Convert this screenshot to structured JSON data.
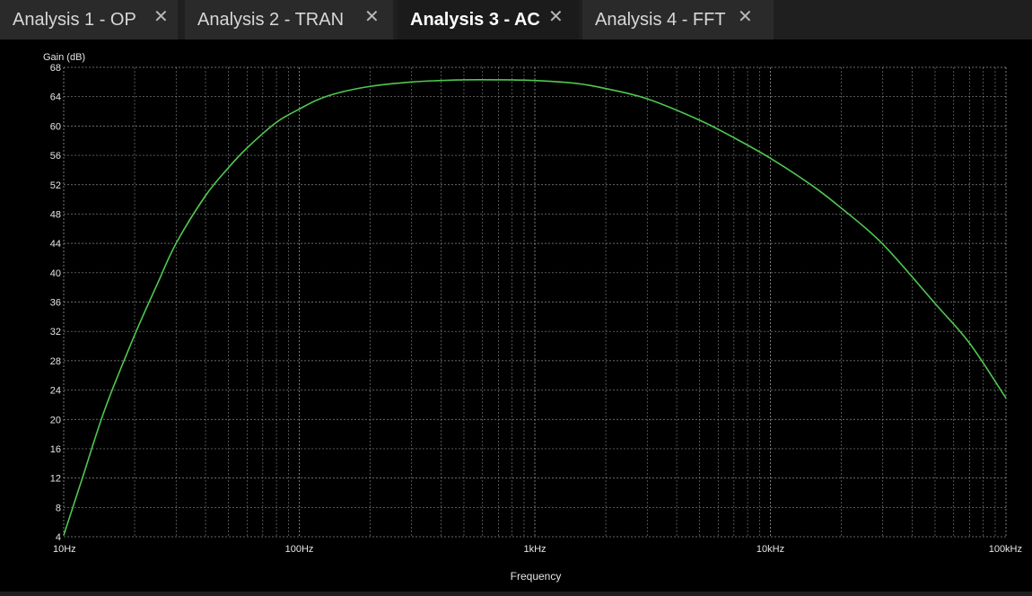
{
  "tabs": [
    {
      "label": "Analysis 1 - OP",
      "active": false
    },
    {
      "label": "Analysis 2 - TRAN",
      "active": false
    },
    {
      "label": "Analysis 3 - AC",
      "active": true
    },
    {
      "label": "Analysis 4 - FFT",
      "active": false
    }
  ],
  "tab_close_glyph": "✕",
  "colors": {
    "trace": "#4fc84f",
    "grid": "#8a8a8a",
    "background": "#000000",
    "text": "#e6e6e6"
  },
  "chart_data": {
    "type": "line",
    "title": "",
    "xlabel": "Frequency",
    "ylabel": "Gain (dB)",
    "xscale": "log",
    "xlim": [
      10,
      100000
    ],
    "ylim": [
      4,
      68
    ],
    "grid": true,
    "x_tick_labels": [
      "10Hz",
      "100Hz",
      "1kHz",
      "10kHz",
      "100kHz"
    ],
    "y_ticks": [
      4,
      8,
      12,
      16,
      20,
      24,
      28,
      32,
      36,
      40,
      44,
      48,
      52,
      56,
      60,
      64,
      68
    ],
    "series": [
      {
        "x": [
          10,
          12,
          15,
          20,
          25,
          30,
          40,
          50,
          60,
          80,
          100,
          120,
          150,
          200,
          300,
          400,
          500,
          700,
          1000,
          1500,
          2000,
          3000,
          5000,
          7000,
          10000,
          15000,
          20000,
          30000,
          50000,
          70000,
          100000
        ],
        "y": [
          4.2,
          12,
          21.5,
          31.5,
          38.5,
          44,
          50.5,
          54.3,
          57,
          60.5,
          62.3,
          63.6,
          64.6,
          65.4,
          66.0,
          66.2,
          66.3,
          66.3,
          66.2,
          65.8,
          65.1,
          63.7,
          60.8,
          58.4,
          55.6,
          51.9,
          48.8,
          43.9,
          35.8,
          30.4,
          22.9
        ]
      }
    ]
  }
}
